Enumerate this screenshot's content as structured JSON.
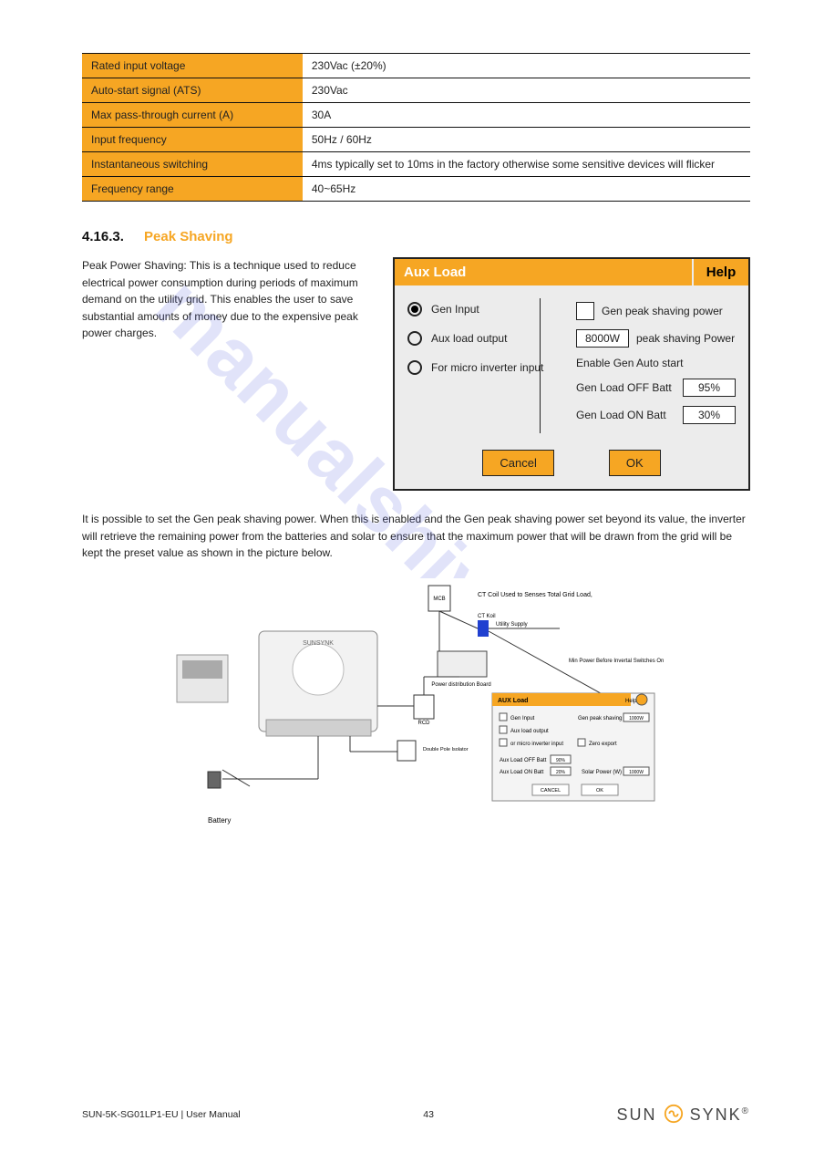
{
  "watermark": "manualshive.com",
  "table": {
    "rows": [
      {
        "label": "Rated input voltage",
        "value": "230Vac (±20%)"
      },
      {
        "label": "Auto-start signal (ATS)",
        "value": "230Vac"
      },
      {
        "label": "Max pass-through current (A)",
        "value": "30A"
      },
      {
        "label": "Input frequency",
        "value": "50Hz / 60Hz"
      },
      {
        "label": "Instantaneous switching",
        "value": "4ms typically set to 10ms in the factory otherwise some sensitive devices will flicker"
      },
      {
        "label": "Frequency range",
        "value": "40~65Hz"
      }
    ]
  },
  "section": {
    "number": "4.16.3.",
    "title": "Peak Shaving"
  },
  "p1": "Peak Power Shaving: This is a technique used to reduce electrical power consumption during periods of maximum demand on the utility grid. This enables the user to save substantial amounts of money due to the expensive peak power charges.",
  "panel": {
    "title": "Aux Load",
    "help": "Help",
    "left": {
      "gen_input": "Gen Input",
      "aux_load_output": "Aux load output",
      "micro_inverter": "For micro inverter input"
    },
    "right": {
      "gen_peak_label": "Gen peak shaving power",
      "peak_shaving_value": "8000W",
      "peak_shaving_label": "peak shaving Power",
      "enable_auto": "Enable Gen Auto start",
      "gen_load_off_label": "Gen Load OFF Batt",
      "gen_load_off_val": "95%",
      "gen_load_on_label": "Gen Load ON Batt",
      "gen_load_on_val": "30%"
    },
    "cancel": "Cancel",
    "ok": "OK"
  },
  "p2": "It is possible to set the Gen peak shaving power. When this is enabled and the Gen peak shaving power set beyond its value, the inverter will retrieve the remaining power from the batteries and solar to ensure that the maximum power that will be drawn from the grid will be kept the preset value as shown in the picture below.",
  "diagram_labels": {
    "ct_coil": "CT Coil Used to Senses Total Grid Load,",
    "ct_koil": "CT Koil",
    "utility": "Utility Supply",
    "pd_board": "Power distribution Board",
    "rcd": "RCD",
    "dpi": "Double Pole Isolator",
    "mcb": "MCB",
    "max_power": "Min Power Before Invertal Switches On",
    "battery": "Battery",
    "mini_panel_title": "AUX Load",
    "mini_help": "Help",
    "mini_gen_input": "Gen Input",
    "mini_aux_out": "Aux load output",
    "mini_micro": "or micro inverter input",
    "mini_gps": "Gen peak shaving power",
    "mini_gps_val": "1000W",
    "mini_zero": "Zero export",
    "mini_off_label": "Aux Load OFF Batt",
    "mini_off_val": "90%",
    "mini_on_label": "Aux Load ON Batt",
    "mini_on_val": "20%",
    "mini_solar_label": "Solar Power (W)",
    "mini_solar_val": "1000W",
    "mini_cancel": "CANCEL",
    "mini_ok": "OK",
    "brand": "SUNSYNK"
  },
  "footer_left": "SUN-5K-SG01LP1-EU | User Manual",
  "footer_page": "43",
  "footer_logo": {
    "left": "SUN",
    "right": "SYNK"
  }
}
